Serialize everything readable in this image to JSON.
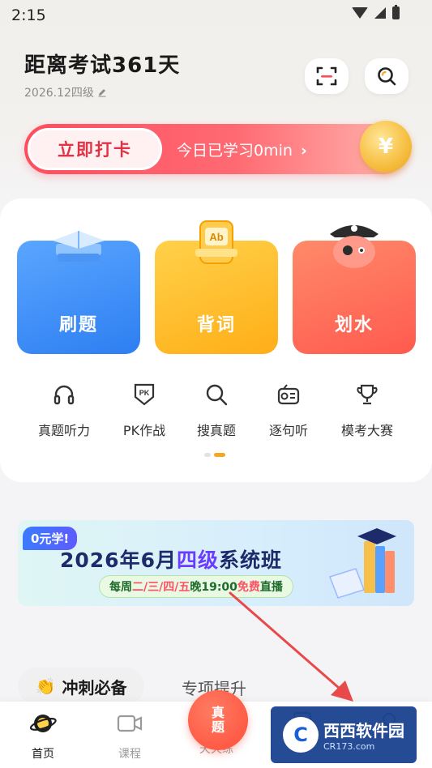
{
  "status_bar": {
    "time": "2:15"
  },
  "header": {
    "title": "距离考试361天",
    "subtitle": "2026.12四级"
  },
  "checkin": {
    "button_label": "立即打卡",
    "progress_text": "今日已学习0min",
    "coin_symbol": "¥"
  },
  "features": [
    {
      "label": "刷题"
    },
    {
      "label": "背词"
    },
    {
      "label": "划水"
    }
  ],
  "quick_actions": [
    {
      "label": "真题听力",
      "icon": "headphones-icon"
    },
    {
      "label": "PK作战",
      "icon": "pk-badge-icon",
      "badge": "PK"
    },
    {
      "label": "搜真题",
      "icon": "search-icon"
    },
    {
      "label": "逐句听",
      "icon": "radio-icon"
    },
    {
      "label": "模考大赛",
      "icon": "trophy-icon"
    }
  ],
  "carousel": {
    "page_count": 2,
    "active_page": 2
  },
  "promo": {
    "tag": "0元学!",
    "title_prefix": "2026年6月",
    "title_highlight": "四级",
    "title_suffix": "系统班",
    "sub_prefix": "每周",
    "sub_days": "二/三/四/五",
    "sub_mid": "晚19:00",
    "sub_accent": "免费",
    "sub_suffix": "直播"
  },
  "tabs": {
    "active": "冲刺必备",
    "inactive": "专项提升"
  },
  "bottom_nav": [
    {
      "label": "首页",
      "icon": "home-planet-icon",
      "active": true
    },
    {
      "label": "课程",
      "icon": "video-icon",
      "active": false
    },
    {
      "label": "天天练",
      "icon": "practice-icon",
      "active": false
    },
    {
      "label": "",
      "icon": "book-icon",
      "active": false
    },
    {
      "label": "",
      "icon": "profile-icon",
      "active": false
    }
  ],
  "center_fab": {
    "label": "真题"
  },
  "watermark": {
    "main": "西西软件园",
    "site": "CR173.com",
    "logo": "C"
  },
  "colors": {
    "brand_red": "#ff4d5e",
    "accent_orange": "#f5a623",
    "blue_card": "#2d7ef2",
    "yellow_card": "#ffae17",
    "red_card": "#ff5a4e"
  }
}
